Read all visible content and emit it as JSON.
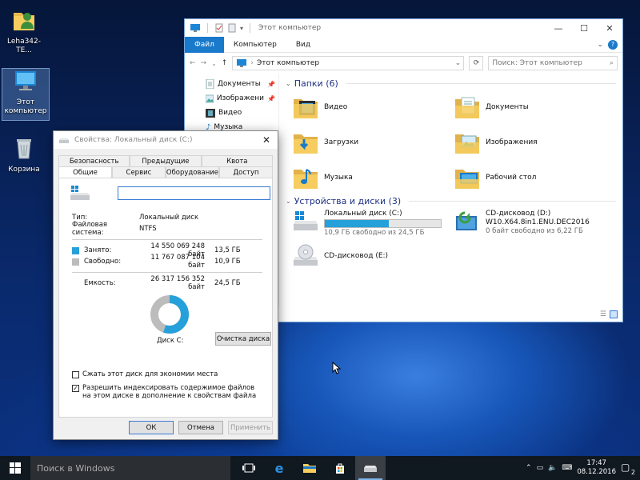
{
  "desktop": {
    "icons": [
      {
        "label": "Leha342-TE..."
      },
      {
        "label": "Этот компьютер"
      },
      {
        "label": "Корзина"
      }
    ]
  },
  "explorer": {
    "title": "Этот компьютер",
    "ribbon_tabs": [
      "Файл",
      "Компьютер",
      "Вид"
    ],
    "address": "Этот компьютер",
    "search_placeholder": "Поиск: Этот компьютер",
    "nav_items": [
      {
        "label": "Документы",
        "icon": "documents-icon"
      },
      {
        "label": "Изображени",
        "icon": "pictures-icon"
      },
      {
        "label": "Видео",
        "icon": "video-icon"
      },
      {
        "label": "Музыка",
        "icon": "music-icon"
      }
    ],
    "folders_group": "Папки (6)",
    "folders": [
      {
        "label": "Видео"
      },
      {
        "label": "Документы"
      },
      {
        "label": "Загрузки"
      },
      {
        "label": "Изображения"
      },
      {
        "label": "Музыка"
      },
      {
        "label": "Рабочий стол"
      }
    ],
    "drives_group": "Устройства и диски (3)",
    "drives": [
      {
        "name": "Локальный диск (C:)",
        "free": "10,9 ГБ свободно из 24,5 ГБ",
        "used_fraction": 0.555
      },
      {
        "name": "CD-дисковод (D:)",
        "label2": "W10.X64.8in1.ENU.DEC2016",
        "free": "0 байт свободно из 6,22 ГБ"
      },
      {
        "name": "CD-дисковод (E:)"
      }
    ]
  },
  "props": {
    "title": "Свойства: Локальный диск (C:)",
    "tabs_row1": [
      "Безопасность",
      "Предыдущие версии",
      "Квота"
    ],
    "tabs_row2": [
      "Общие",
      "Сервис",
      "Оборудование",
      "Доступ"
    ],
    "name_value": "",
    "type_label": "Тип:",
    "type_value": "Локальный диск",
    "fs_label": "Файловая система:",
    "fs_value": "NTFS",
    "used_label": "Занято:",
    "used_bytes": "14 550 069 248 байт",
    "used_gb": "13,5 ГБ",
    "free_label": "Свободно:",
    "free_bytes": "11 767 087 104 байт",
    "free_gb": "10,9 ГБ",
    "cap_label": "Емкость:",
    "cap_bytes": "26 317 156 352 байт",
    "cap_gb": "24,5 ГБ",
    "used_fraction": 0.553,
    "disk_label": "Диск C:",
    "cleanup_btn": "Очистка диска",
    "compress_label": "Сжать этот диск для экономии места",
    "compress_checked": false,
    "index_label": "Разрешить индексировать содержимое файлов на этом диске в дополнение к свойствам файла",
    "index_checked": true,
    "ok": "ОК",
    "cancel": "Отмена",
    "apply": "Применить",
    "colors": {
      "used": "#26a0da",
      "free": "#bcbcbc"
    }
  },
  "taskbar": {
    "search_placeholder": "Поиск в Windows",
    "time": "17:47",
    "date": "08.12.2016",
    "notifications": "2"
  }
}
